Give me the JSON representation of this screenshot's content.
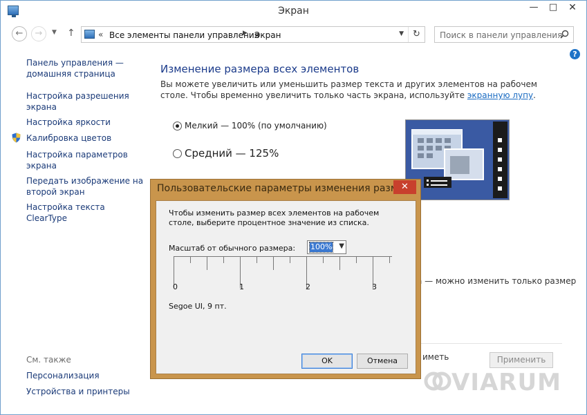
{
  "window": {
    "title": "Экран",
    "min_symbol": "—",
    "max_symbol": "□",
    "close_symbol": "✕"
  },
  "navbar": {
    "back_symbol": "←",
    "forward_symbol": "→",
    "history_symbol": "▼",
    "up_symbol": "↑",
    "address_chevron": "«",
    "crumbs": [
      "Все элементы панели управления",
      "Экран"
    ],
    "crumb_separator": "▶",
    "address_dropdown_symbol": "▼",
    "refresh_symbol": "↻",
    "search_placeholder": "Поиск в панели управления"
  },
  "help_symbol": "?",
  "sidebar": {
    "items": [
      "Панель управления — домашняя страница",
      "Настройка разрешения экрана",
      "Настройка яркости",
      "Калибровка цветов",
      "Настройка параметров экрана",
      "Передать изображение на второй экран",
      "Настройка текста ClearType"
    ],
    "see_also_title": "См. также",
    "see_also": [
      "Персонализация",
      "Устройства и принтеры"
    ]
  },
  "main": {
    "title": "Изменение размера всех элементов",
    "desc_part1": "Вы можете увеличить или уменьшить размер текста и других элементов на рабочем столе. Чтобы временно увеличить только часть экрана, используйте ",
    "desc_link": "экранную лупу",
    "desc_end": ".",
    "options": [
      {
        "label": "Мелкий — 100% (по умолчанию)",
        "selected": true
      },
      {
        "label": "Средний — 125%",
        "selected": false
      }
    ],
    "partial_text_right": "а — можно изменить только размер",
    "partial_text_bottom": "иметь",
    "apply_label": "Применить"
  },
  "dialog": {
    "title": "Пользовательские параметры изменения разм",
    "close_symbol": "✕",
    "description": "Чтобы изменить размер всех элементов на рабочем столе, выберите процентное значение из списка.",
    "scale_label": "Масштаб от обычного размера:",
    "scale_value": "100%",
    "scale_dropdown_symbol": "▼",
    "ruler_labels": [
      "0",
      "1",
      "2",
      "3"
    ],
    "font_info": "Segoe UI, 9 пт.",
    "ok_label": "OK",
    "cancel_label": "Отмена"
  },
  "watermark": "VIARUM",
  "colors": {
    "accent_link": "#1a3a78",
    "title_blue": "#1a3a8a",
    "dialog_frame": "#c9954c",
    "dialog_close": "#c8402d",
    "preview_bg": "#3a5aa3"
  }
}
